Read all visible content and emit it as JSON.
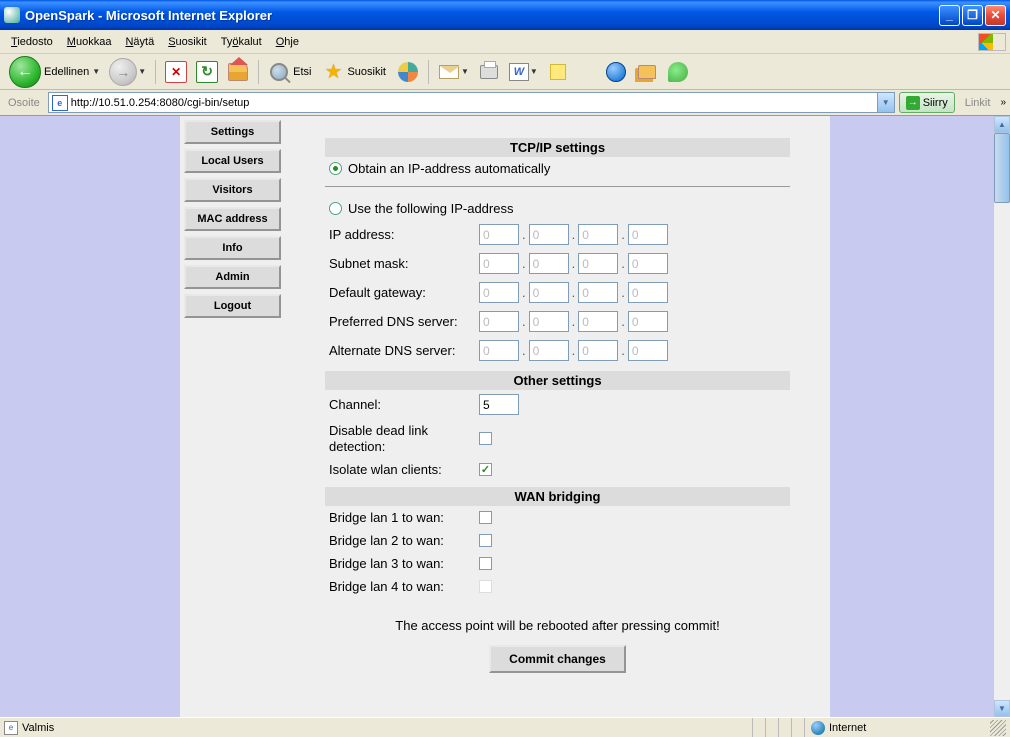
{
  "window": {
    "title": "OpenSpark - Microsoft Internet Explorer"
  },
  "menu": {
    "tiedosto": "Tiedosto",
    "muokkaa": "Muokkaa",
    "nayta": "Näytä",
    "suosikit": "Suosikit",
    "tyokalut": "Työkalut",
    "ohje": "Ohje"
  },
  "toolbar": {
    "edellinen": "Edellinen",
    "etsi": "Etsi",
    "suosikit": "Suosikit",
    "word_glyph": "W"
  },
  "addressbar": {
    "osoite": "Osoite",
    "url": "http://10.51.0.254:8080/cgi-bin/setup",
    "siirry": "Siirry",
    "linkit": "Linkit"
  },
  "sidebar": {
    "items": [
      {
        "label": "Settings"
      },
      {
        "label": "Local Users"
      },
      {
        "label": "Visitors"
      },
      {
        "label": "MAC address"
      },
      {
        "label": "Info"
      },
      {
        "label": "Admin"
      },
      {
        "label": "Logout"
      }
    ]
  },
  "form": {
    "section_tcp": "TCP/IP settings",
    "radio_auto": "Obtain an IP-address automatically",
    "radio_manual": "Use the following IP-address",
    "ip_label": "IP address:",
    "subnet_label": "Subnet mask:",
    "gateway_label": "Default gateway:",
    "dns1_label": "Preferred DNS server:",
    "dns2_label": "Alternate DNS server:",
    "ip": [
      "0",
      "0",
      "0",
      "0"
    ],
    "subnet": [
      "0",
      "0",
      "0",
      "0"
    ],
    "gateway": [
      "0",
      "0",
      "0",
      "0"
    ],
    "dns1": [
      "0",
      "0",
      "0",
      "0"
    ],
    "dns2": [
      "0",
      "0",
      "0",
      "0"
    ],
    "section_other": "Other settings",
    "channel_label": "Channel:",
    "channel_value": "5",
    "deadlink_label": "Disable dead link detection:",
    "deadlink_checked": false,
    "isolate_label": "Isolate wlan clients:",
    "isolate_checked": true,
    "section_wan": "WAN bridging",
    "bridge1_label": "Bridge lan 1 to wan:",
    "bridge2_label": "Bridge lan 2 to wan:",
    "bridge3_label": "Bridge lan 3 to wan:",
    "bridge4_label": "Bridge lan 4 to wan:",
    "bridge1_checked": false,
    "bridge2_checked": false,
    "bridge3_checked": false,
    "bridge4_checked": false,
    "note": "The access point will be rebooted after pressing commit!",
    "commit": "Commit changes"
  },
  "status": {
    "valmis": "Valmis",
    "internet": "Internet"
  }
}
